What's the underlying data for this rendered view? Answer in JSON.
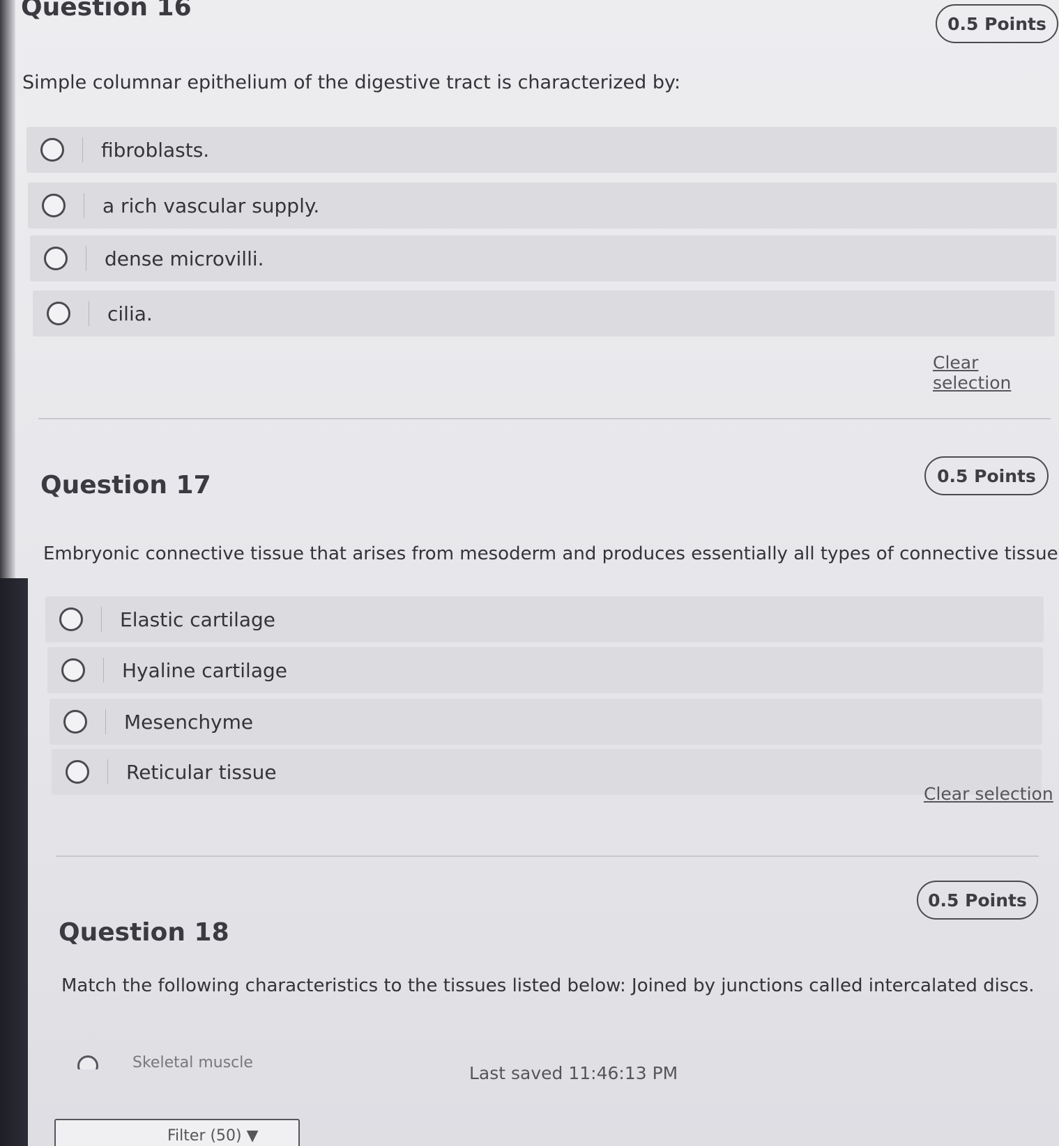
{
  "questions": [
    {
      "title": "Question 16",
      "points": "0.5 Points",
      "prompt": "Simple columnar epithelium of the digestive tract is characterized by:",
      "options": [
        "fibroblasts.",
        "a rich vascular supply.",
        "dense microvilli.",
        "cilia."
      ],
      "clear_label": "Clear selection"
    },
    {
      "title": "Question 17",
      "points": "0.5 Points",
      "prompt": "Embryonic connective tissue that arises from mesoderm and produces essentially all types of connective tissues.",
      "options": [
        "Elastic cartilage",
        "Hyaline cartilage",
        "Mesenchyme",
        "Reticular tissue"
      ],
      "clear_label": "Clear selection"
    },
    {
      "title": "Question 18",
      "points": "0.5 Points",
      "prompt": "Match the following characteristics to the tissues listed below: Joined by junctions called intercalated discs.",
      "options": [
        "Skeletal muscle"
      ]
    }
  ],
  "footer": {
    "last_saved": "Last saved 11:46:13 PM",
    "filter_label": "Filter (50)"
  }
}
